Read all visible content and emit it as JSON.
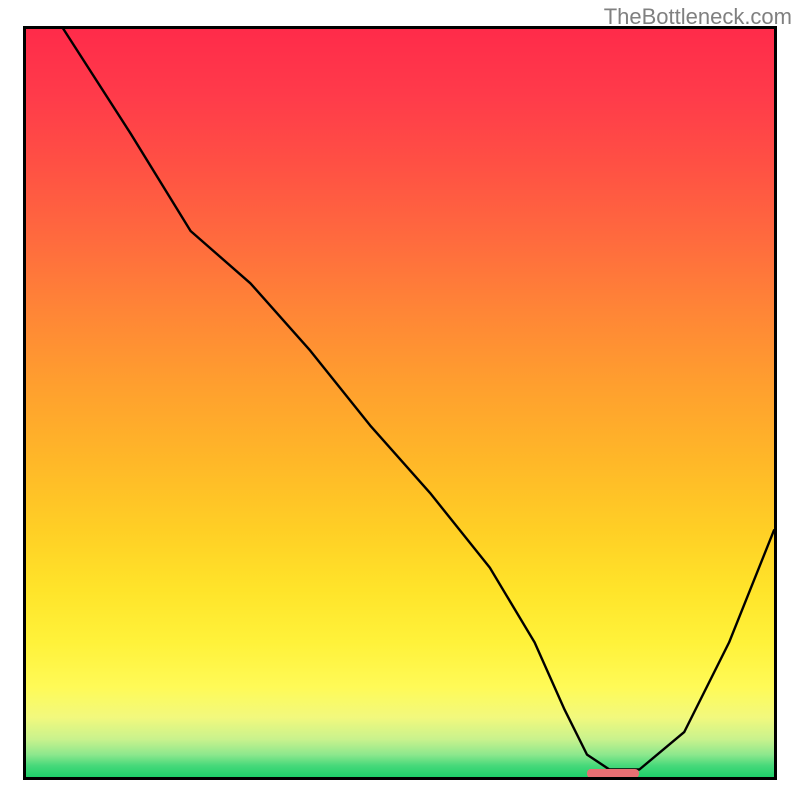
{
  "watermark": "TheBottleneck.com",
  "chart_data": {
    "type": "line",
    "title": "",
    "xlabel": "",
    "ylabel": "",
    "xlim": [
      0,
      100
    ],
    "ylim": [
      0,
      100
    ],
    "grid": false,
    "legend": false,
    "background": "rainbow_vertical_gradient",
    "series": [
      {
        "name": "bottleneck-curve",
        "x": [
          5,
          14,
          22,
          30,
          38,
          46,
          54,
          62,
          68,
          72,
          75,
          78,
          82,
          88,
          94,
          100
        ],
        "y": [
          100,
          86,
          73,
          66,
          57,
          47,
          38,
          28,
          18,
          9,
          3,
          1,
          1,
          6,
          18,
          33
        ],
        "color": "#000000"
      }
    ],
    "annotations": [
      {
        "name": "optimal-marker",
        "type": "segment",
        "x_start": 75,
        "x_end": 82,
        "y": 0.5,
        "color": "#e86f73"
      }
    ]
  }
}
